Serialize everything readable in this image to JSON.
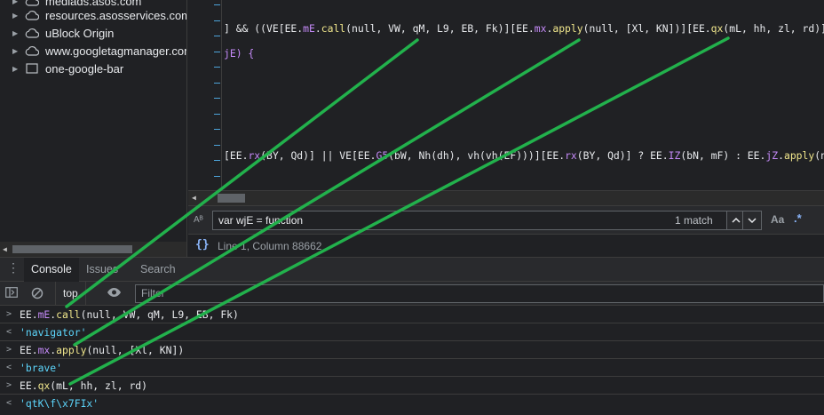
{
  "navigator": {
    "items": [
      {
        "label": "mediads.asos.com",
        "icon": "cloud-icon",
        "expanded": false
      },
      {
        "label": "resources.asosservices.com",
        "icon": "cloud-icon",
        "expanded": false
      },
      {
        "label": "uBlock Origin",
        "icon": "cloud-icon",
        "expanded": false
      },
      {
        "label": "www.googletagmanager.com",
        "icon": "cloud-icon",
        "expanded": false
      },
      {
        "label": "one-google-bar",
        "icon": "frame-icon",
        "expanded": false
      }
    ]
  },
  "editor": {
    "line_a": {
      "t1": "] && ((VE[EE.",
      "p1": "mE",
      "t2": ".",
      "p2": "call",
      "t3": "(null, VW, qM, L9, EB, Fk)][EE.",
      "p3": "mx",
      "t4": ".",
      "p4": "apply",
      "t5": "(null, [Xl, KN])][EE.",
      "p5": "qx",
      "t6": "(mL, hh, zl, rd)]())["
    },
    "line_b": "jE) {",
    "line_c": {
      "t1": "[EE.",
      "p1": "rx",
      "t2": "(BY, Qd)] || VE[EE.",
      "p2": "G5",
      "t3": "(bW, Nh(dh), vh(vh(EF)))][EE.",
      "p3": "rx",
      "t4": "(BY, Qd)] ? EE.",
      "p4": "IZ",
      "t5": "(bN, mF) : EE.",
      "p5": "jZ",
      "t6": ".",
      "p6": "apply",
      "t7": "(null,"
    }
  },
  "search": {
    "kind_icon": "Aᴮ",
    "query": "var wjE = function",
    "match_count": "1 match",
    "prev_icon": "chevron-up-icon",
    "next_icon": "chevron-down-icon",
    "match_case_label": "Aa",
    "regex_label": ".*"
  },
  "status": {
    "format_label": "{}",
    "cursor_position": "Line 1, Column 88662"
  },
  "drawer": {
    "tabs": [
      {
        "label": "Console",
        "active": true
      },
      {
        "label": "Issues",
        "active": false
      },
      {
        "label": "Search",
        "active": false
      }
    ]
  },
  "console_toolbar": {
    "context": "top",
    "filter_placeholder": "Filter"
  },
  "console": {
    "messages": [
      {
        "kind": "input",
        "prefix": ">",
        "text_a": "EE.",
        "prop": "mE",
        "text_b": ".",
        "method": "call",
        "text_c": "(null, VW, qM, L9, EB, Fk)"
      },
      {
        "kind": "result",
        "prefix": "<",
        "value": "'navigator'"
      },
      {
        "kind": "input",
        "prefix": ">",
        "text_a": "EE.",
        "prop": "mx",
        "text_b": ".",
        "method": "apply",
        "text_c": "(null, [Xl, KN])"
      },
      {
        "kind": "result",
        "prefix": "<",
        "value": "'brave'"
      },
      {
        "kind": "input",
        "prefix": ">",
        "text_a": "EE.",
        "prop": "qx",
        "text_b": "",
        "method": "",
        "text_c": "(mL, hh, zl, rd)"
      },
      {
        "kind": "result",
        "prefix": "<",
        "value": "'qtK\\f\\x7FIx'"
      }
    ]
  },
  "colors": {
    "background": "#202124",
    "panel": "#292a2d",
    "accent": "#8ab4f8",
    "property": "#c58af9",
    "string_result": "#5cd5fb",
    "annotation": "#22b14c"
  }
}
